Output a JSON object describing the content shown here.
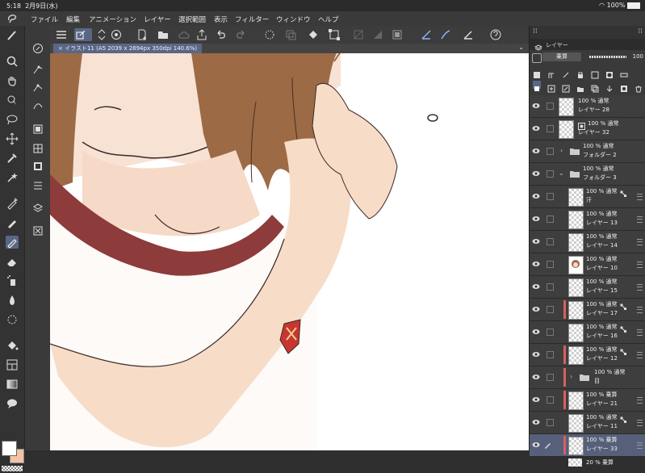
{
  "status": {
    "time": "5:18",
    "date": "2月9日(水)",
    "battery": "100%"
  },
  "menu": [
    "ファイル",
    "編集",
    "アニメーション",
    "レイヤー",
    "選択範囲",
    "表示",
    "フィルター",
    "ウィンドウ",
    "ヘルプ"
  ],
  "doc": {
    "tab_title": "イラスト11 (A5 2039 x 2894px 350dpi 140.6%)"
  },
  "layer_panel": {
    "tab_label": "レイヤー",
    "blend_mode": "乗算",
    "opacity": "100",
    "layers": [
      {
        "line1": "100 % 通常",
        "line2": "レイヤー 28"
      },
      {
        "line1": "100 % 通常",
        "line2": "レイヤー 32"
      },
      {
        "line1": "100 % 通常",
        "line2": "フォルダー 2"
      },
      {
        "line1": "100 % 通常",
        "line2": "フォルダー 3"
      },
      {
        "line1": "100 % 通常",
        "line2": "汗"
      },
      {
        "line1": "100 % 通常",
        "line2": "レイヤー 13"
      },
      {
        "line1": "100 % 通常",
        "line2": "レイヤー 14"
      },
      {
        "line1": "100 % 通常",
        "line2": "レイヤー 10"
      },
      {
        "line1": "100 % 通常",
        "line2": "レイヤー 15"
      },
      {
        "line1": "100 % 通常",
        "line2": "レイヤー 17"
      },
      {
        "line1": "100 % 通常",
        "line2": "レイヤー 16"
      },
      {
        "line1": "100 % 通常",
        "line2": "レイヤー 12"
      },
      {
        "line1": "100 % 通常",
        "line2": "目"
      },
      {
        "line1": "100 % 乗算",
        "line2": "レイヤー 21"
      },
      {
        "line1": "100 % 通常",
        "line2": "レイヤー 11"
      },
      {
        "line1": "100 % 乗算",
        "line2": "レイヤー 33"
      },
      {
        "line1": "20 % 乗算",
        "line2": ""
      }
    ]
  },
  "colors": {
    "main": "#ffffff",
    "sub": "#f4c3a4",
    "accent": "#5a6784"
  }
}
